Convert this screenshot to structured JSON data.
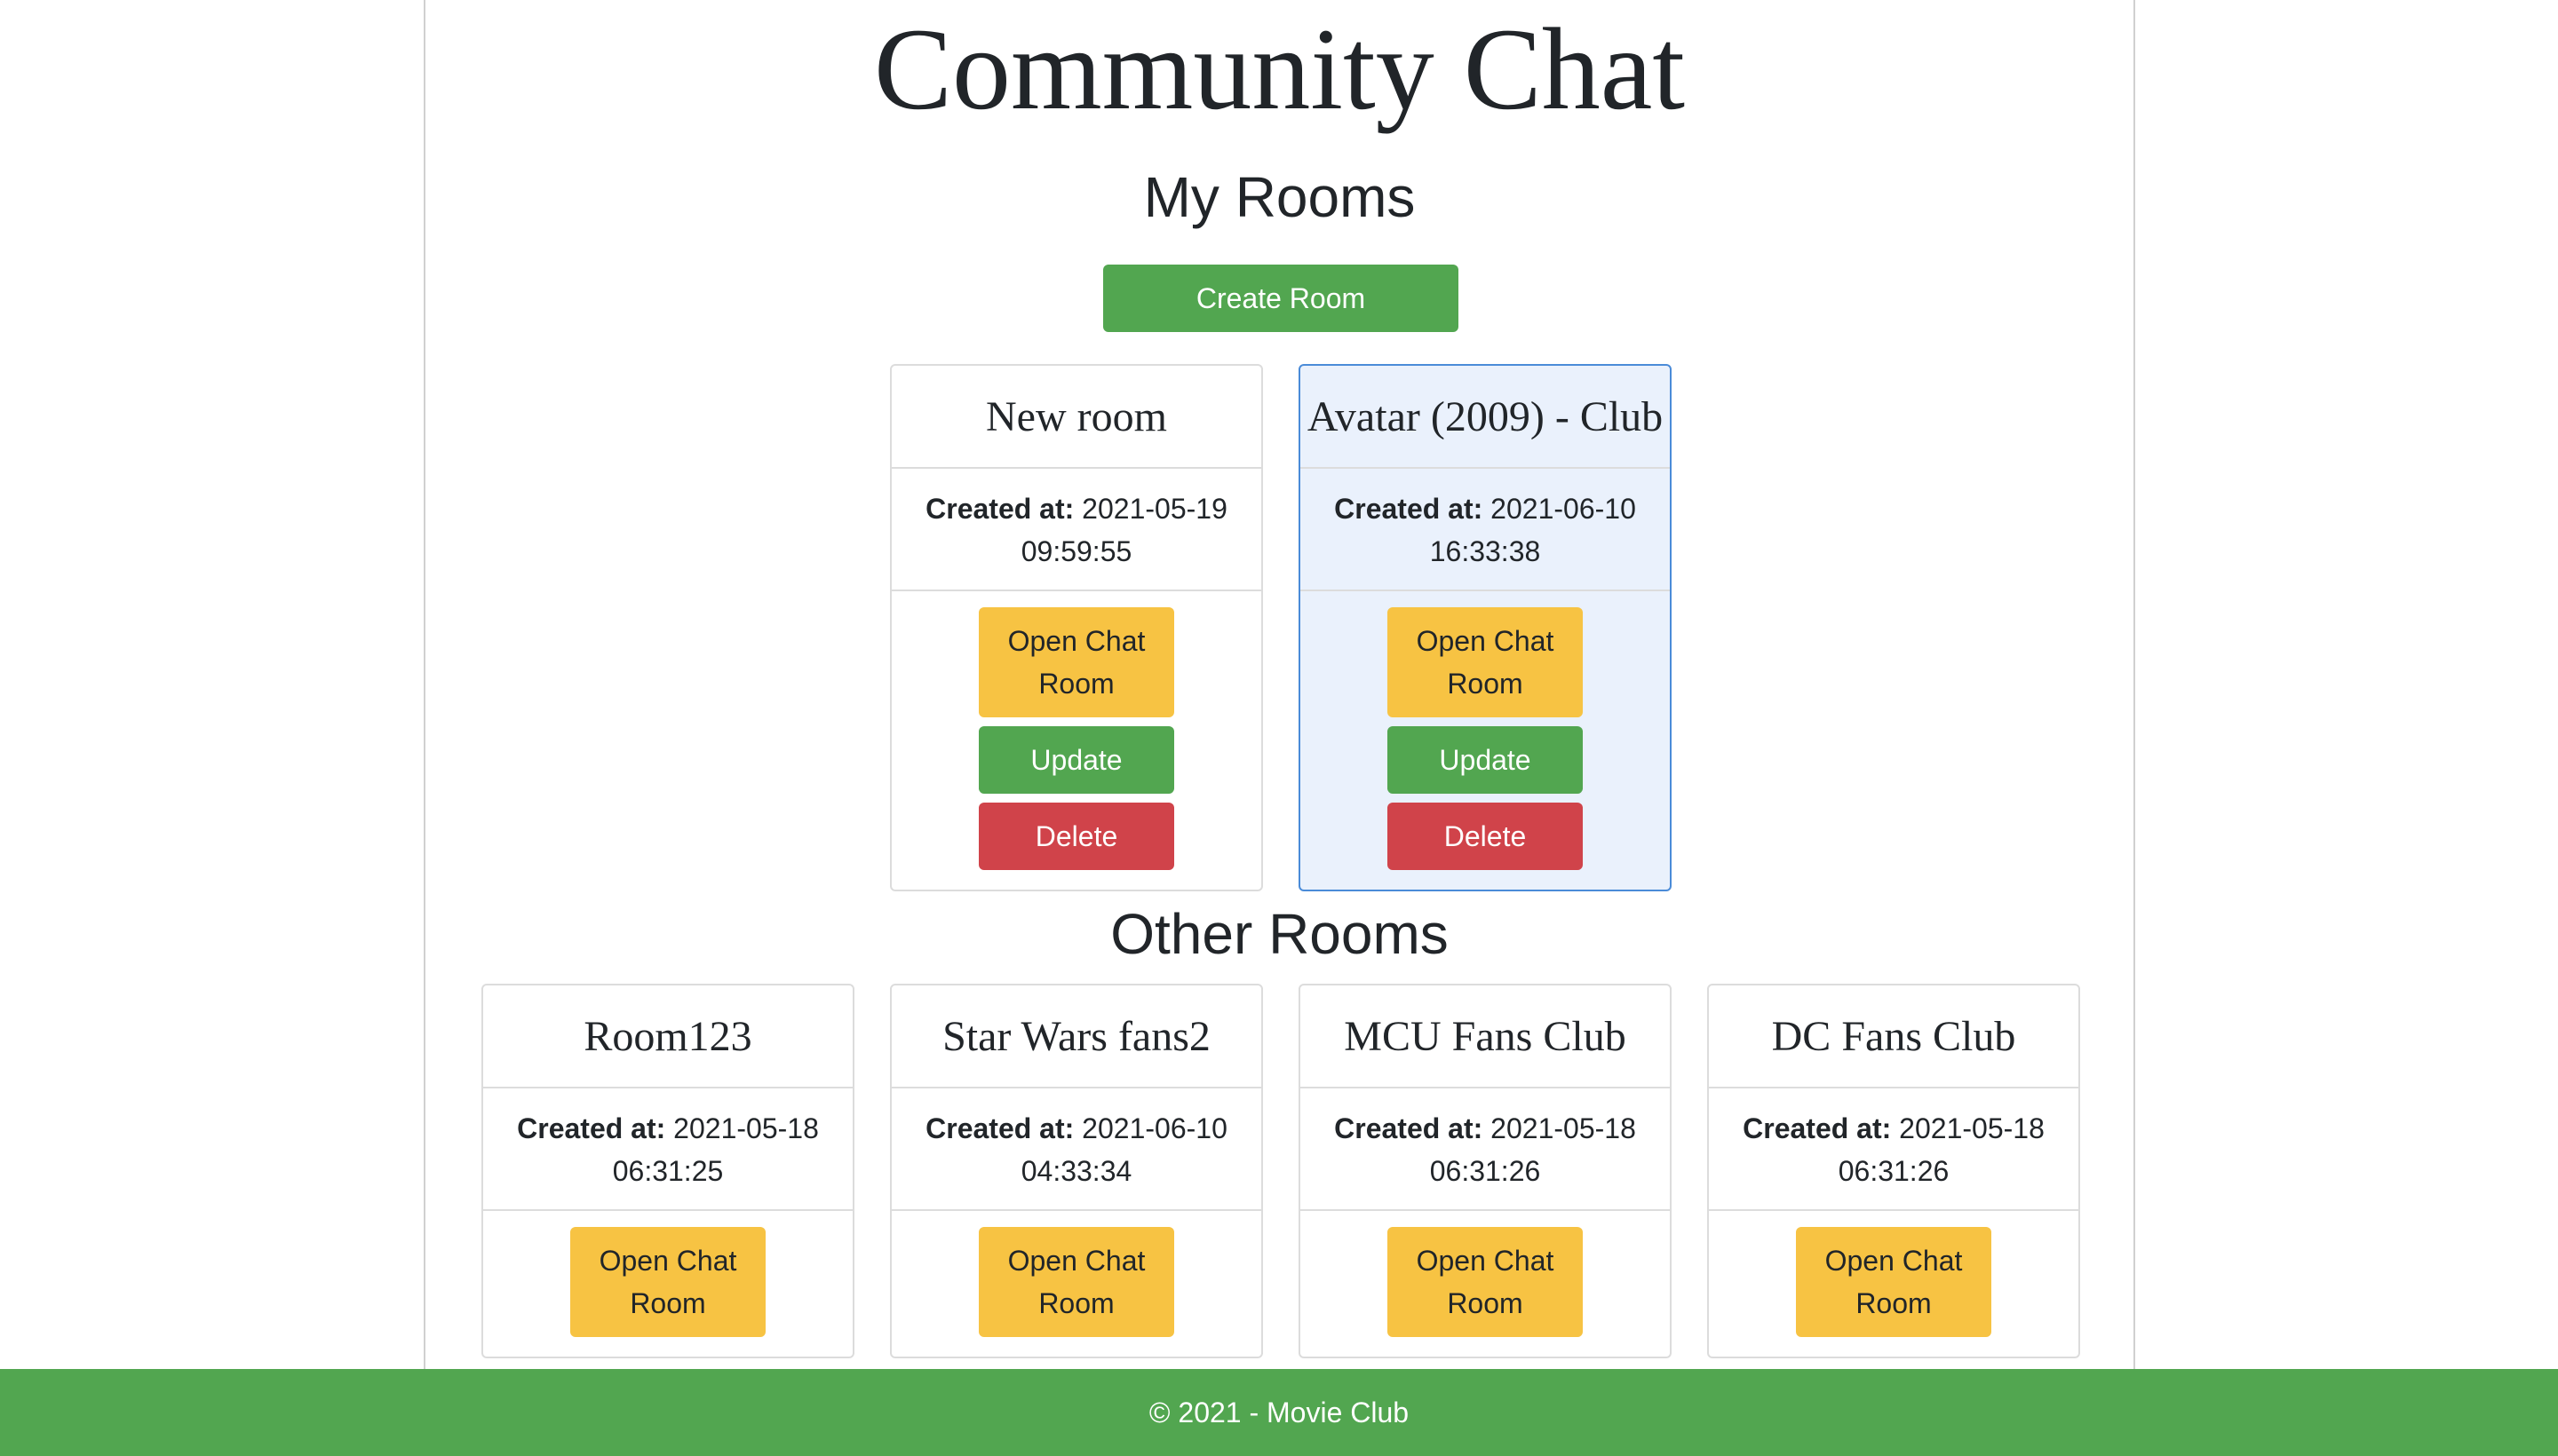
{
  "page": {
    "title": "Community Chat"
  },
  "my_rooms": {
    "heading": "My Rooms",
    "create_label": "Create Room",
    "rooms": [
      {
        "name": "New room",
        "created_label": "Created at:",
        "created_at": "2021-05-19 09:59:55",
        "open_label": "Open Chat Room",
        "update_label": "Update",
        "delete_label": "Delete",
        "highlighted": false
      },
      {
        "name": "Avatar (2009) - Club",
        "created_label": "Created at:",
        "created_at": "2021-06-10 16:33:38",
        "open_label": "Open Chat Room",
        "update_label": "Update",
        "delete_label": "Delete",
        "highlighted": true
      }
    ]
  },
  "other_rooms": {
    "heading": "Other Rooms",
    "rooms": [
      {
        "name": "Room123",
        "created_label": "Created at:",
        "created_at": "2021-05-18 06:31:25",
        "open_label": "Open Chat Room"
      },
      {
        "name": "Star Wars fans2",
        "created_label": "Created at:",
        "created_at": "2021-06-10 04:33:34",
        "open_label": "Open Chat Room"
      },
      {
        "name": "MCU Fans Club",
        "created_label": "Created at:",
        "created_at": "2021-05-18 06:31:26",
        "open_label": "Open Chat Room"
      },
      {
        "name": "DC Fans Club",
        "created_label": "Created at:",
        "created_at": "2021-05-18 06:31:26",
        "open_label": "Open Chat Room"
      }
    ]
  },
  "footer": {
    "text": "© 2021 - Movie Club"
  },
  "colors": {
    "primary_green": "#52a650",
    "warning_yellow": "#f7c343",
    "danger_red": "#d0434a",
    "highlight_bg": "#eaf1fc",
    "highlight_border": "#4a8bd8"
  }
}
